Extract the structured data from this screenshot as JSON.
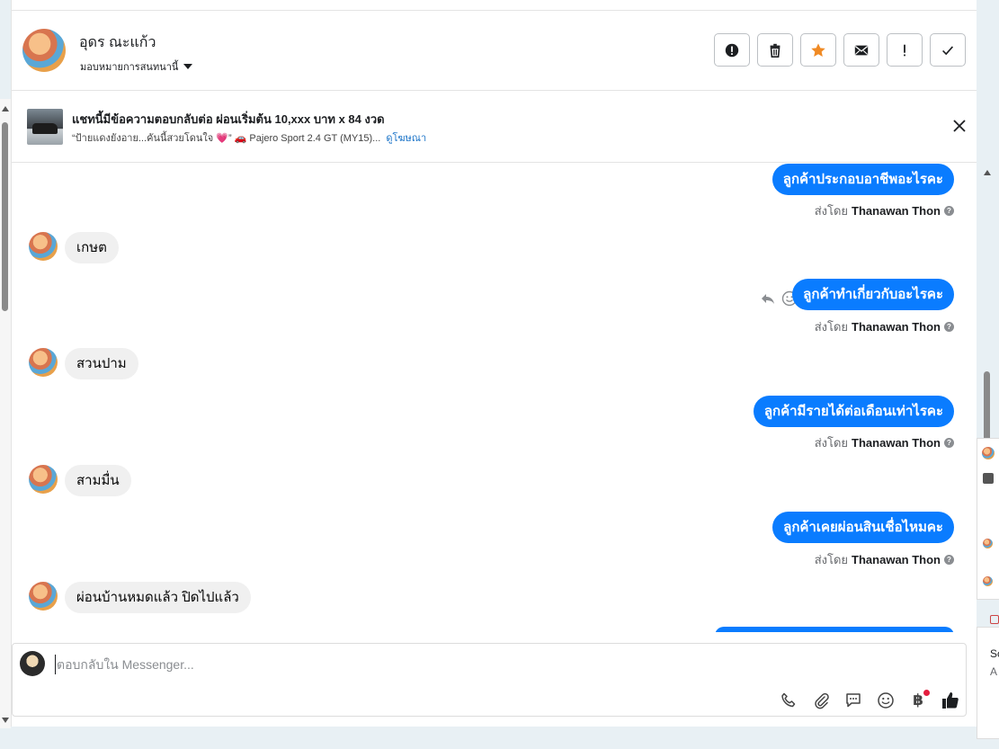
{
  "header": {
    "contact_name": "อุดร ณะแก้ว",
    "assign_label": "มอบหมายการสนทนานี้",
    "actions": [
      {
        "name": "report-spam-button",
        "icon": "exclamation-circle-icon"
      },
      {
        "name": "delete-button",
        "icon": "trash-icon"
      },
      {
        "name": "star-button",
        "icon": "star-icon"
      },
      {
        "name": "mark-unread-button",
        "icon": "envelope-icon"
      },
      {
        "name": "follow-up-button",
        "icon": "exclamation-icon"
      },
      {
        "name": "mark-done-button",
        "icon": "check-icon"
      }
    ],
    "star_color": "#f08a24"
  },
  "ad": {
    "title": "แชทนี้มีข้อความตอบกลับต่อ ผ่อนเริ่มต้น 10,xxx บาท x 84 งวด",
    "subtitle": "“ป้ายแดงยังอาย...คันนี้สวยโดนใจ 💗” 🚗 Pajero Sport 2.4 GT (MY15)...",
    "link": "ดูโฆษณา"
  },
  "messages": [
    {
      "dir": "out",
      "text": "ลูกค้าประกอบอาชีพอะไรคะ",
      "sent_by_label": "ส่งโดย",
      "sender": "Thanawan Thon"
    },
    {
      "dir": "in",
      "text": "เกษต"
    },
    {
      "dir": "out",
      "text": "ลูกค้าทำเกี่ยวกับอะไรคะ",
      "sent_by_label": "ส่งโดย",
      "sender": "Thanawan Thon"
    },
    {
      "dir": "in",
      "text": "สวนปาม"
    },
    {
      "dir": "out",
      "text": "ลูกค้ามีรายได้ต่อเดือนเท่าไรคะ",
      "sent_by_label": "ส่งโดย",
      "sender": "Thanawan Thon"
    },
    {
      "dir": "in",
      "text": "สามมื่น"
    },
    {
      "dir": "out",
      "text": "ลูกค้าเคยผ่อนสินเชื่อไหมคะ",
      "sent_by_label": "ส่งโดย",
      "sender": "Thanawan Thon"
    },
    {
      "dir": "in",
      "text": "ผ่อนบ้านหมดแล้ว ปิดไปแล้ว"
    }
  ],
  "composer": {
    "placeholder": "ตอบกลับใน Messenger...",
    "tools": [
      "phone-icon",
      "paperclip-icon",
      "saved-replies-icon",
      "emoji-icon",
      "baht-payment-icon",
      "thumbs-up-icon"
    ],
    "baht_symbol": "฿"
  },
  "side_panel": {
    "line1": "Sc",
    "line2": "A"
  },
  "colors": {
    "outgoing_bubble": "#0a7cff",
    "incoming_bubble": "#f0f0f0",
    "link": "#1a73c8"
  }
}
